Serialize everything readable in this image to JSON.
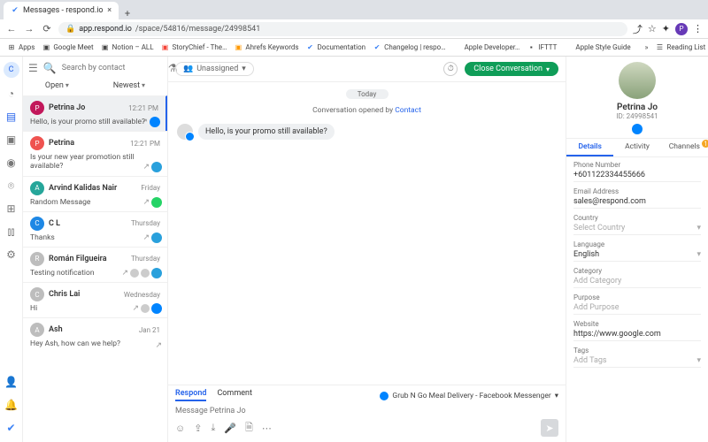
{
  "browser": {
    "tab_title": "Messages - respond.io",
    "url_host": "app.respond.io",
    "url_path": "/space/54816/message/24998541",
    "bookmarks": [
      "Apps",
      "Google Meet",
      "Notion – ALL",
      "StoryChief - The…",
      "Ahrefs Keywords",
      "Documentation",
      "Changelog | respo…",
      "Apple Developer…",
      "IFTTT",
      "Apple Style Guide"
    ],
    "reading_list": "Reading List"
  },
  "rail": {
    "org_initial": "C"
  },
  "list": {
    "search_placeholder": "Search by contact",
    "filter_open": "Open",
    "filter_newest": "Newest",
    "items": [
      {
        "name": "Petrina Jo",
        "time": "12:21 PM",
        "snippet": "Hello, is your promo still available?",
        "avatar_bg": "#c2185b",
        "channels": [
          "fb"
        ],
        "selected": true
      },
      {
        "name": "Petrina",
        "time": "12:21 PM",
        "snippet": "Is your new year promotion still available?",
        "avatar_bg": "#ef5350",
        "channels": [
          "tg"
        ]
      },
      {
        "name": "Arvind Kalidas Nair",
        "time": "Friday",
        "snippet": "Random Message",
        "avatar_bg": "#26a69a",
        "channels": [
          "wa"
        ]
      },
      {
        "name": "C L",
        "time": "Thursday",
        "snippet": "Thanks",
        "avatar_bg": "#1e88e5",
        "channels": [
          "tg"
        ]
      },
      {
        "name": "Román Filgueira",
        "time": "Thursday",
        "snippet": "Testing notification",
        "avatar_bg": "#bdbdbd",
        "channels": [
          "tg"
        ],
        "agents": 2
      },
      {
        "name": "Chris Lai",
        "time": "Wednesday",
        "snippet": "Hi",
        "avatar_bg": "#bdbdbd",
        "channels": [
          "fb"
        ],
        "agents": 1
      },
      {
        "name": "Ash",
        "time": "Jan 21",
        "snippet": "Hey Ash, how can we help?",
        "avatar_bg": "#bdbdbd",
        "channels": []
      }
    ]
  },
  "conversation": {
    "assign_label": "Unassigned",
    "close_label": "Close Conversation",
    "date_chip": "Today",
    "system_prefix": "Conversation opened by ",
    "system_link": "Contact",
    "first_message": "Hello, is your promo still available?"
  },
  "composer": {
    "tabs": [
      "Respond",
      "Comment"
    ],
    "source": "Grub N Go Meal Delivery - Facebook Messenger",
    "placeholder": "Message Petrina Jo"
  },
  "profile": {
    "name": "Petrina Jo",
    "id": "ID: 24998541",
    "tabs": [
      "Details",
      "Activity",
      "Channels"
    ],
    "fields": [
      {
        "label": "Phone Number",
        "value": "+601122334455666"
      },
      {
        "label": "Email Address",
        "value": "sales@respond.com"
      },
      {
        "label": "Country",
        "value": "Select Country",
        "placeholder": true,
        "chevron": true
      },
      {
        "label": "Language",
        "value": "English",
        "chevron": true
      },
      {
        "label": "Category",
        "value": "Add Category",
        "placeholder": true
      },
      {
        "label": "Purpose",
        "value": "Add Purpose",
        "placeholder": true
      },
      {
        "label": "Website",
        "value": "https://www.google.com"
      },
      {
        "label": "Tags",
        "value": "Add Tags",
        "placeholder": true,
        "chevron": true
      }
    ]
  }
}
